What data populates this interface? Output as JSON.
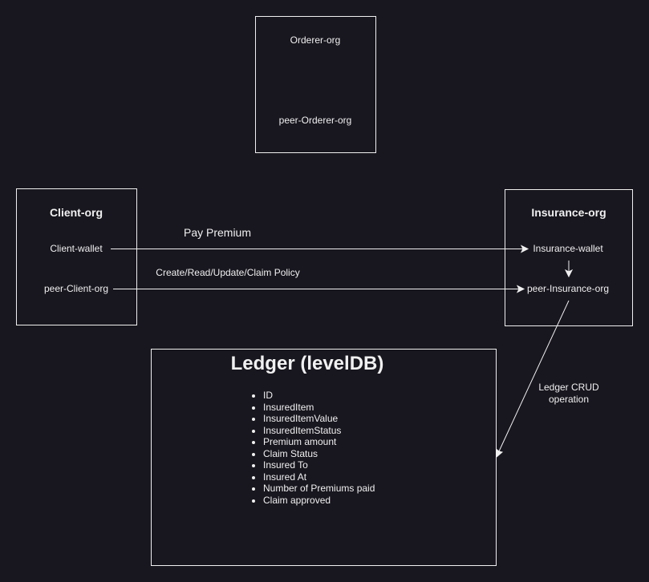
{
  "orderer": {
    "title": "Orderer-org",
    "peer": "peer-Orderer-org"
  },
  "client": {
    "title": "Client-org",
    "wallet": "Client-wallet",
    "peer": "peer-Client-org"
  },
  "insurance": {
    "title": "Insurance-org",
    "wallet": "Insurance-wallet",
    "peer": "peer-Insurance-org"
  },
  "edges": {
    "pay": "Pay Premium",
    "policy": "Create/Read/Update/Claim Policy",
    "crud": "Ledger CRUD operation"
  },
  "ledger": {
    "title": "Ledger (levelDB)",
    "fields": [
      "ID",
      "InsuredItem",
      "InsuredItemValue",
      "InsuredItemStatus",
      "Premium amount",
      "Claim Status",
      "Insured To",
      "Insured At",
      "Number of Premiums paid",
      "Claim approved"
    ]
  },
  "colors": {
    "background": "#18161e",
    "stroke": "#f0f0f0"
  }
}
